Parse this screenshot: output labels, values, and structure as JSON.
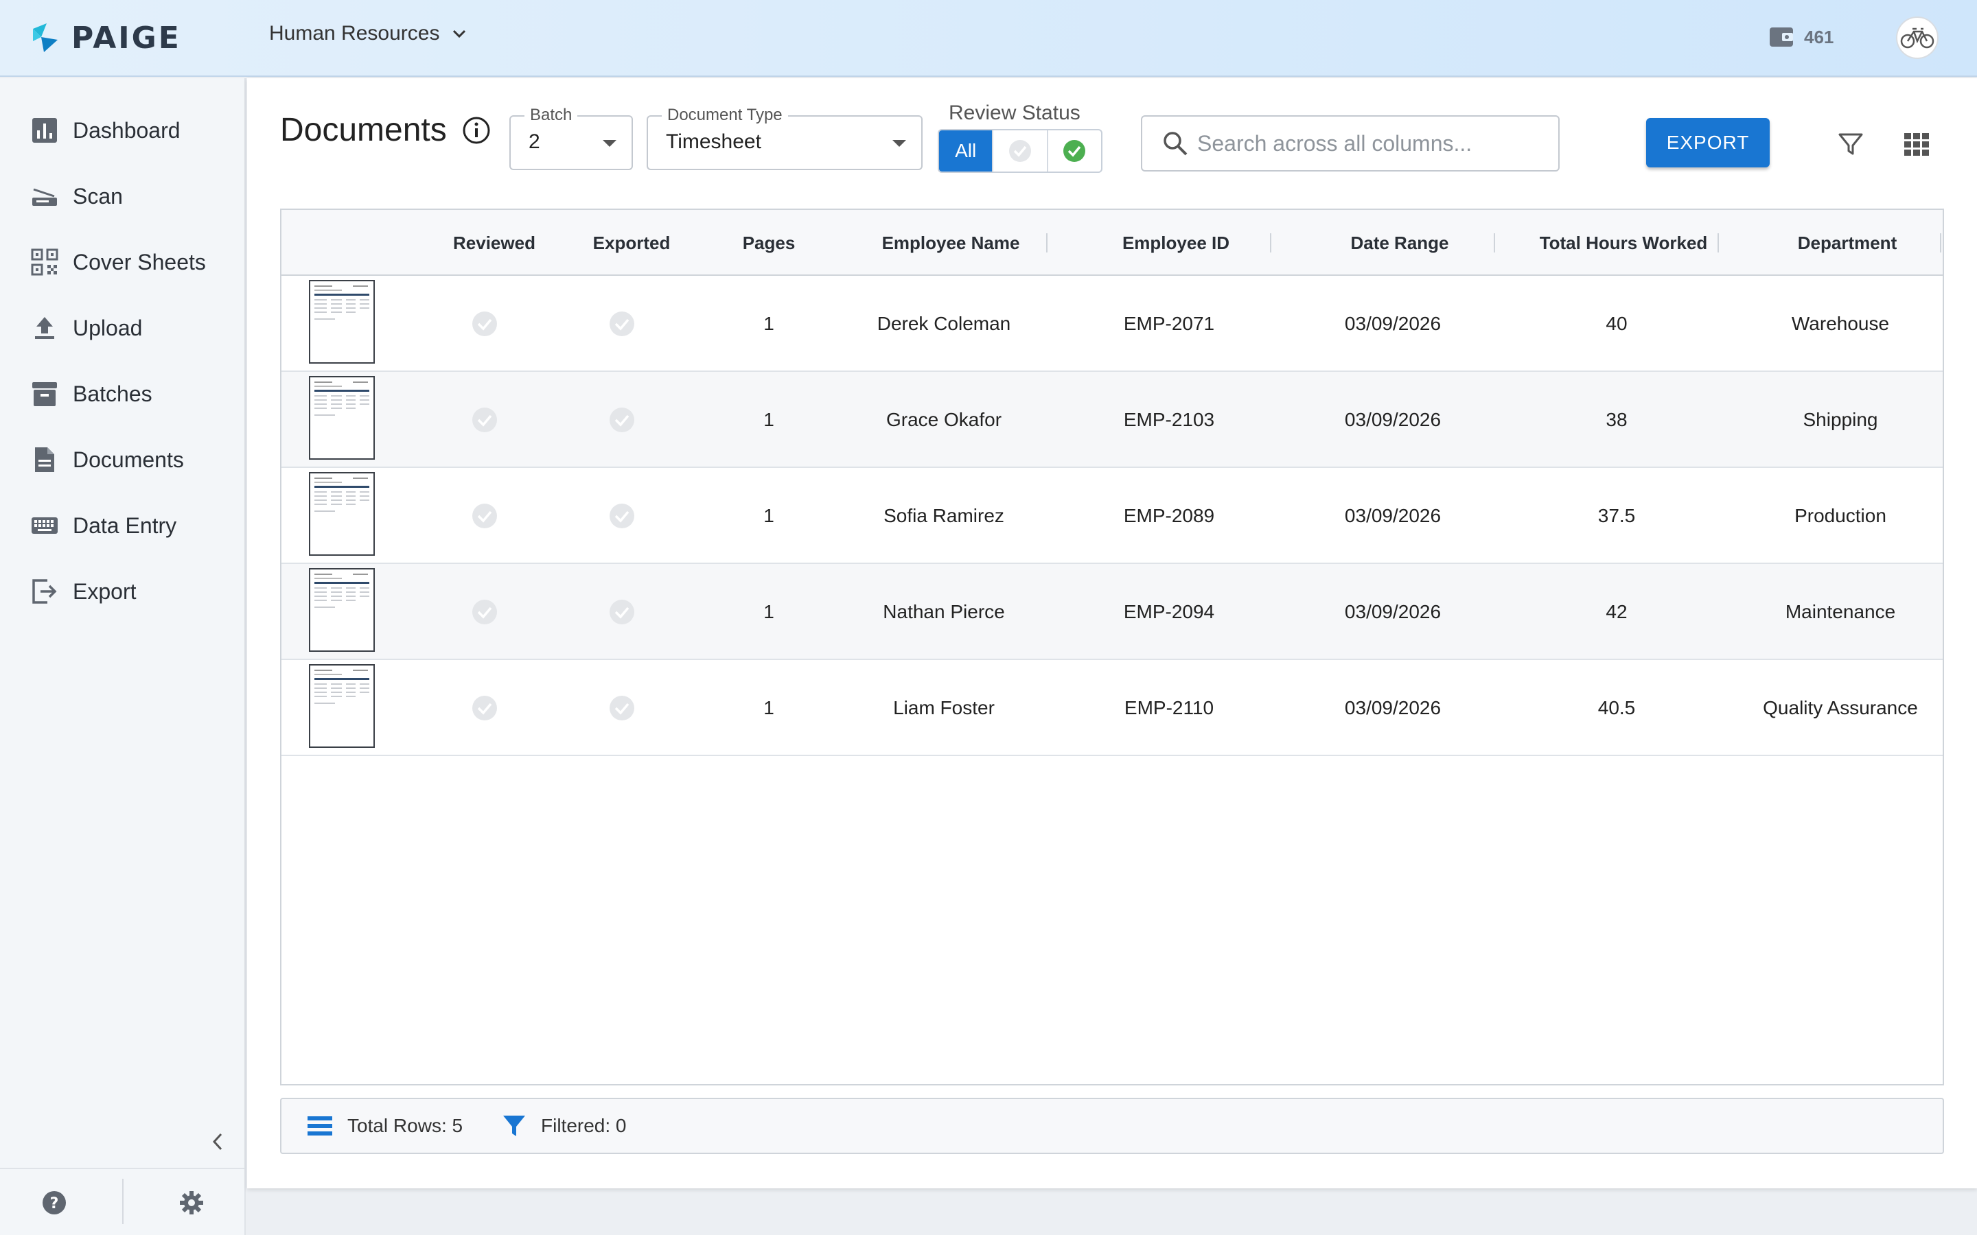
{
  "header": {
    "brand": "PAIGE",
    "workspace": "Human Resources",
    "credits": "461"
  },
  "sidebar": {
    "items": [
      {
        "label": "Dashboard",
        "icon": "bar-chart-icon"
      },
      {
        "label": "Scan",
        "icon": "scanner-icon"
      },
      {
        "label": "Cover Sheets",
        "icon": "qr-code-icon"
      },
      {
        "label": "Upload",
        "icon": "upload-icon"
      },
      {
        "label": "Batches",
        "icon": "archive-icon"
      },
      {
        "label": "Documents",
        "icon": "document-icon"
      },
      {
        "label": "Data Entry",
        "icon": "keyboard-icon"
      },
      {
        "label": "Export",
        "icon": "export-icon"
      }
    ]
  },
  "toolbar": {
    "title": "Documents",
    "batch_label": "Batch",
    "batch_value": "2",
    "doctype_label": "Document Type",
    "doctype_value": "Timesheet",
    "review_label": "Review Status",
    "review_all": "All",
    "search_placeholder": "Search across all columns...",
    "export_label": "EXPORT"
  },
  "table": {
    "columns": [
      "",
      "Reviewed",
      "Exported",
      "Pages",
      "Employee Name",
      "Employee ID",
      "Date Range",
      "Total Hours Worked",
      "Department"
    ],
    "rows": [
      {
        "pages": "1",
        "name": "Derek Coleman",
        "id": "EMP-2071",
        "date": "03/09/2026",
        "hours": "40",
        "dept": "Warehouse"
      },
      {
        "pages": "1",
        "name": "Grace Okafor",
        "id": "EMP-2103",
        "date": "03/09/2026",
        "hours": "38",
        "dept": "Shipping"
      },
      {
        "pages": "1",
        "name": "Sofia Ramirez",
        "id": "EMP-2089",
        "date": "03/09/2026",
        "hours": "37.5",
        "dept": "Production"
      },
      {
        "pages": "1",
        "name": "Nathan Pierce",
        "id": "EMP-2094",
        "date": "03/09/2026",
        "hours": "42",
        "dept": "Maintenance"
      },
      {
        "pages": "1",
        "name": "Liam Foster",
        "id": "EMP-2110",
        "date": "03/09/2026",
        "hours": "40.5",
        "dept": "Quality Assurance"
      }
    ]
  },
  "footer": {
    "total_rows": "Total Rows: 5",
    "filtered": "Filtered: 0"
  },
  "colors": {
    "primary": "#1976d2",
    "success": "#4caf50",
    "check_muted": "#e4e6e9"
  }
}
